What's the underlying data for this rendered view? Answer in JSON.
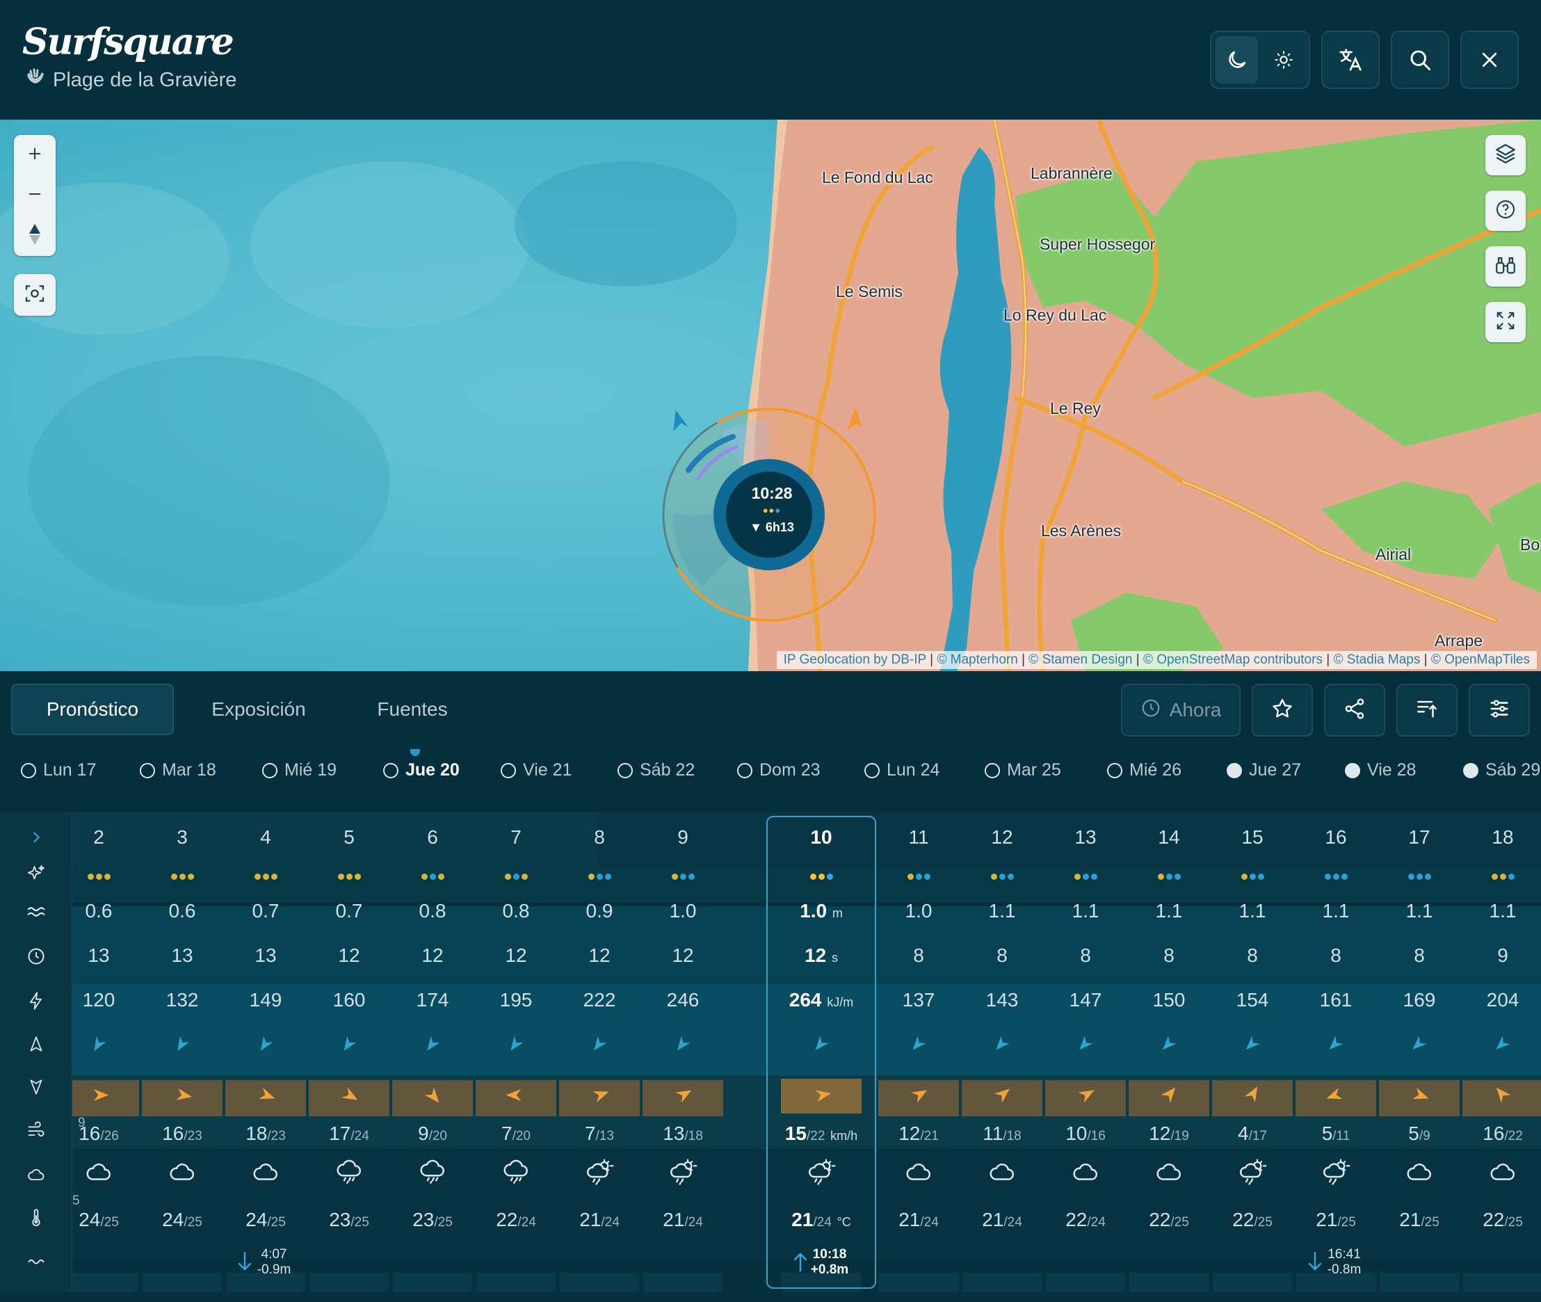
{
  "app": {
    "title": "Surfsquare",
    "spot": "Plage de la Gravière"
  },
  "header": {
    "icons": [
      "moon-icon",
      "sun-icon",
      "translate-icon",
      "search-icon",
      "close-icon"
    ]
  },
  "map": {
    "places": [
      "Le Fond du Lac",
      "Labrannère",
      "Super Hossegor",
      "Le Semis",
      "Lo Rey du Lac",
      "Le Rey",
      "Les Arènes",
      "Airial",
      "Bo",
      "Arrape"
    ],
    "attribution": [
      "IP Geolocation by DB-IP",
      "© Mapterhorn",
      "© Stamen Design",
      "© OpenStreetMap contributors",
      "© Stadia Maps",
      "© OpenMapTiles"
    ],
    "marker": {
      "time": "10:28",
      "tide": "▼ 6h13"
    },
    "colors": {
      "sea": "#52b7cc",
      "land": "#e4a790",
      "forest": "#86c96b",
      "road": "#f0a338",
      "lake": "#2f9cbf"
    }
  },
  "tabs": [
    "Pronóstico",
    "Exposición",
    "Fuentes"
  ],
  "toolbar": {
    "now": "Ahora"
  },
  "days": [
    {
      "label": "Lun 17",
      "phase": 0.45
    },
    {
      "label": "Mar 18",
      "phase": 0.55
    },
    {
      "label": "Mié 19",
      "phase": 0.6
    },
    {
      "label": "Jue 20",
      "phase": 0.65,
      "active": true
    },
    {
      "label": "Vie 21",
      "phase": 0.7
    },
    {
      "label": "Sáb 22",
      "phase": 0.75
    },
    {
      "label": "Dom 23",
      "phase": 0.8
    },
    {
      "label": "Lun 24",
      "phase": 0.85
    },
    {
      "label": "Mar 25",
      "phase": 0.9
    },
    {
      "label": "Mié 26",
      "phase": 0.95
    },
    {
      "label": "Jue 27",
      "phase": 1
    },
    {
      "label": "Vie 28",
      "phase": 1
    },
    {
      "label": "Sáb 29",
      "phase": 1
    }
  ],
  "edge": {
    "wind_gust": "9",
    "temp": "5"
  },
  "hours": [
    {
      "hour": "2",
      "stars": [
        "#d8b43a",
        "#d8b43a",
        "#d8b43a"
      ],
      "height": "0.6",
      "period": "13",
      "energy": "120",
      "wind": "16",
      "gust": "/26",
      "temp": "24",
      "temp2": "/25",
      "weather": "cloud"
    },
    {
      "hour": "3",
      "stars": [
        "#d8b43a",
        "#d8b43a",
        "#d8b43a"
      ],
      "height": "0.6",
      "period": "13",
      "energy": "132",
      "wind": "16",
      "gust": "/23",
      "temp": "24",
      "temp2": "/25",
      "weather": "cloud"
    },
    {
      "hour": "4",
      "stars": [
        "#d8b43a",
        "#d8b43a",
        "#d8b43a"
      ],
      "height": "0.7",
      "period": "13",
      "energy": "149",
      "wind": "18",
      "gust": "/23",
      "temp": "24",
      "temp2": "/25",
      "weather": "cloud",
      "tide": {
        "dir": "down",
        "time": "4:07",
        "height": "-0.9m"
      }
    },
    {
      "hour": "5",
      "stars": [
        "#d8b43a",
        "#d8b43a",
        "#d8b43a"
      ],
      "height": "0.7",
      "period": "12",
      "energy": "160",
      "wind": "17",
      "gust": "/24",
      "temp": "23",
      "temp2": "/25",
      "weather": "rain"
    },
    {
      "hour": "6",
      "stars": [
        "#d8b43a",
        "#2b9fd0",
        "#d8b43a"
      ],
      "height": "0.8",
      "period": "12",
      "energy": "174",
      "wind": "9",
      "gust": "/20",
      "temp": "23",
      "temp2": "/25",
      "weather": "rain"
    },
    {
      "hour": "7",
      "stars": [
        "#d8b43a",
        "#2b9fd0",
        "#d8b43a"
      ],
      "height": "0.8",
      "period": "12",
      "energy": "195",
      "wind": "7",
      "gust": "/20",
      "temp": "22",
      "temp2": "/24",
      "weather": "rain"
    },
    {
      "hour": "8",
      "stars": [
        "#d8b43a",
        "#2b9fd0",
        "#2b9fd0"
      ],
      "height": "0.9",
      "period": "12",
      "energy": "222",
      "wind": "7",
      "gust": "/13",
      "temp": "21",
      "temp2": "/24",
      "weather": "sunrain"
    },
    {
      "hour": "9",
      "stars": [
        "#d8b43a",
        "#2b9fd0",
        "#2b9fd0"
      ],
      "height": "1.0",
      "period": "12",
      "energy": "246",
      "wind": "13",
      "gust": "/18",
      "temp": "21",
      "temp2": "/24",
      "weather": "sunrain"
    },
    {
      "hour": "10",
      "stars": [
        "#f2c23a",
        "#f2c23a",
        "#33a8e0"
      ],
      "height": "1.0",
      "height_unit": "m",
      "period": "12",
      "period_unit": "s",
      "energy": "264",
      "energy_unit": "kJ/m",
      "wind": "15",
      "gust": "/22",
      "wind_unit": "km/h",
      "temp": "21",
      "temp2": "/24",
      "temp_unit": "°C",
      "weather": "sunrain",
      "current": true,
      "tide": {
        "dir": "up",
        "time": "10:18",
        "height": "+0.8m"
      }
    },
    {
      "hour": "11",
      "stars": [
        "#d8b43a",
        "#2b9fd0",
        "#2b9fd0"
      ],
      "height": "1.0",
      "period": "8",
      "energy": "137",
      "wind": "12",
      "gust": "/21",
      "temp": "21",
      "temp2": "/24",
      "weather": "cloud"
    },
    {
      "hour": "12",
      "stars": [
        "#d8b43a",
        "#2b9fd0",
        "#2b9fd0"
      ],
      "height": "1.1",
      "period": "8",
      "energy": "143",
      "wind": "11",
      "gust": "/18",
      "temp": "21",
      "temp2": "/24",
      "weather": "cloud"
    },
    {
      "hour": "13",
      "stars": [
        "#d8b43a",
        "#2b9fd0",
        "#2b9fd0"
      ],
      "height": "1.1",
      "period": "8",
      "energy": "147",
      "wind": "10",
      "gust": "/16",
      "temp": "22",
      "temp2": "/24",
      "weather": "cloud"
    },
    {
      "hour": "14",
      "stars": [
        "#d8b43a",
        "#2b9fd0",
        "#2b9fd0"
      ],
      "height": "1.1",
      "period": "8",
      "energy": "150",
      "wind": "12",
      "gust": "/19",
      "temp": "22",
      "temp2": "/25",
      "weather": "cloud"
    },
    {
      "hour": "15",
      "stars": [
        "#d8b43a",
        "#2b9fd0",
        "#2b9fd0"
      ],
      "height": "1.1",
      "period": "8",
      "energy": "154",
      "wind": "4",
      "gust": "/17",
      "temp": "22",
      "temp2": "/25",
      "weather": "sunrain"
    },
    {
      "hour": "16",
      "stars": [
        "#2b9fd0",
        "#2b9fd0",
        "#2b9fd0"
      ],
      "height": "1.1",
      "period": "8",
      "energy": "161",
      "wind": "5",
      "gust": "/11",
      "temp": "21",
      "temp2": "/25",
      "weather": "sunrain",
      "tide": {
        "dir": "down",
        "time": "16:41",
        "height": "-0.8m"
      }
    },
    {
      "hour": "17",
      "stars": [
        "#2b9fd0",
        "#2b9fd0",
        "#2b9fd0"
      ],
      "height": "1.1",
      "period": "8",
      "energy": "169",
      "wind": "5",
      "gust": "/9",
      "temp": "21",
      "temp2": "/25",
      "weather": "cloud"
    },
    {
      "hour": "18",
      "stars": [
        "#d8b43a",
        "#d8b43a",
        "#2b9fd0"
      ],
      "height": "1.1",
      "period": "9",
      "energy": "204",
      "wind": "16",
      "gust": "/22",
      "temp": "22",
      "temp2": "/25",
      "weather": "cloud"
    }
  ]
}
